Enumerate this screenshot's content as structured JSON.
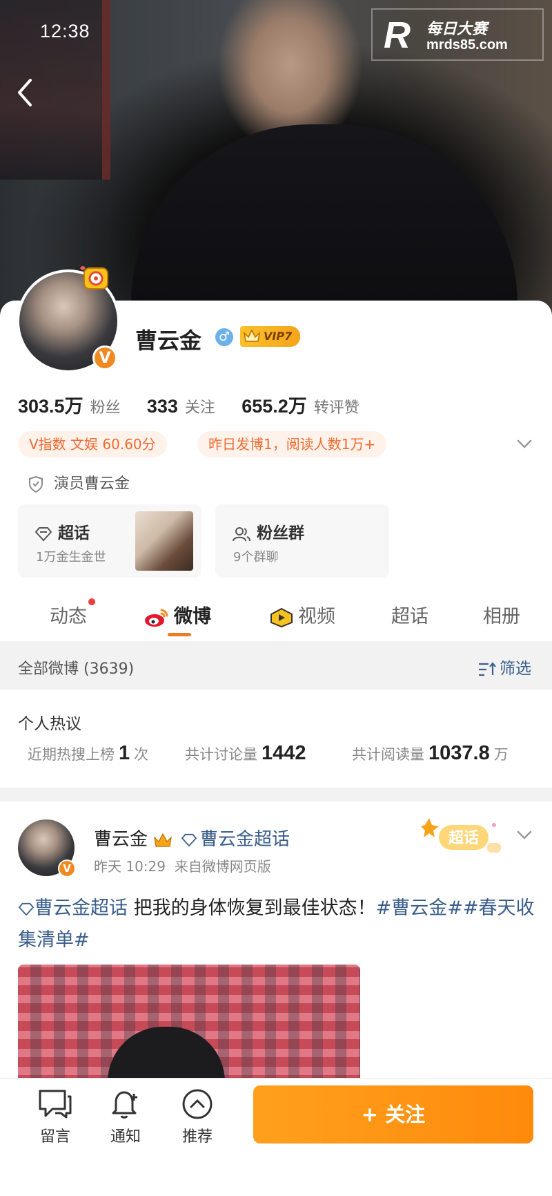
{
  "status_bar": {
    "time": "12:38"
  },
  "watermark": {
    "line1": "每日大赛",
    "line2": "mrds85.com",
    "mark": "R"
  },
  "profile": {
    "name": "曹云金",
    "gender_symbol": "♂",
    "vip_label": "VIP7",
    "verified_badge": "V",
    "stats": [
      {
        "value": "303.5万",
        "label": "粉丝"
      },
      {
        "value": "333",
        "label": "关注"
      },
      {
        "value": "655.2万",
        "label": "转评赞"
      }
    ],
    "tags": [
      "V指数 文娱 60.60分",
      "昨日发博1，阅读人数1万+"
    ],
    "verification": "演员曹云金"
  },
  "boxes": {
    "super_topic": {
      "title": "超话",
      "subtitle": "1万金生金世"
    },
    "fan_group": {
      "title": "粉丝群",
      "subtitle": "9个群聊"
    }
  },
  "tabs": [
    {
      "label": "动态"
    },
    {
      "label": "微博"
    },
    {
      "label": "视频"
    },
    {
      "label": "超话"
    },
    {
      "label": "相册"
    }
  ],
  "filter": {
    "all_posts": "全部微博 (3639)",
    "filter_label": "筛选"
  },
  "hot_topic": {
    "heading": "个人热议",
    "items": [
      {
        "label": "近期热搜上榜",
        "value": "1",
        "unit": "次"
      },
      {
        "label": "共计讨论量",
        "value": "1442",
        "unit": ""
      },
      {
        "label": "共计阅读量",
        "value": "1037.8",
        "unit": "万"
      }
    ]
  },
  "post": {
    "author": "曹云金",
    "topic": "曹云金超话",
    "time": "昨天 10:29",
    "source": "来自微博网页版",
    "badge": "超话",
    "text_topic": "曹云金超话",
    "text_body": " 把我的身体恢复到最佳状态！",
    "hashtags": "#曹云金##春天收集清单#"
  },
  "bottom_bar": {
    "message": "留言",
    "notify": "通知",
    "recommend": "推荐",
    "follow": "+ 关注"
  },
  "colors": {
    "accent": "#ff8a0c",
    "link": "#3a5e8c",
    "tag_text": "#f06a30"
  }
}
